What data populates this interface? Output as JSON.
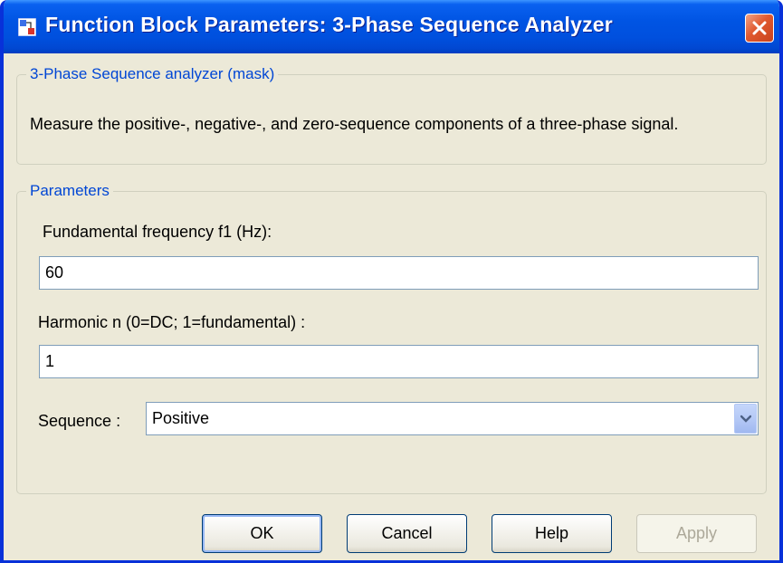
{
  "window": {
    "title": "Function Block Parameters: 3-Phase Sequence Analyzer"
  },
  "mask": {
    "legend": "3-Phase Sequence analyzer (mask)",
    "description": "Measure the positive-, negative-, and zero-sequence components of a three-phase signal."
  },
  "parameters": {
    "legend": "Parameters",
    "frequency_label": "Fundamental frequency f1 (Hz):",
    "frequency_value": "60",
    "harmonic_label": "Harmonic n (0=DC; 1=fundamental) :",
    "harmonic_value": "1",
    "sequence_label": "Sequence :",
    "sequence_value": "Positive"
  },
  "buttons": {
    "ok": "OK",
    "cancel": "Cancel",
    "help": "Help",
    "apply": "Apply"
  },
  "colors": {
    "titlebar": "#0054e3",
    "legend_text": "#0046d5",
    "dialog_bg": "#ece9d8",
    "close_button": "#e0592f"
  }
}
